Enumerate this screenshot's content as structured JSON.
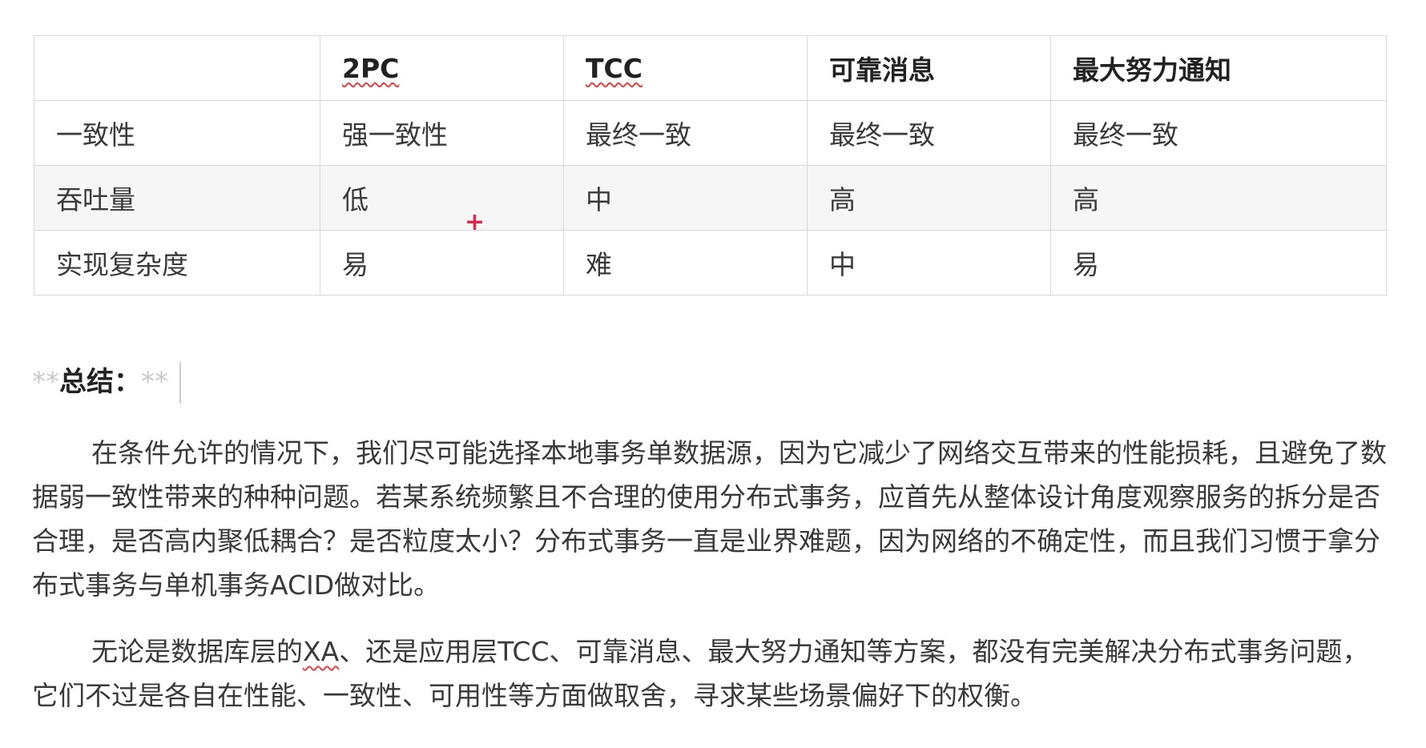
{
  "table": {
    "headers": [
      "",
      "2PC",
      "TCC",
      "可靠消息",
      "最大努力通知"
    ],
    "rows": [
      [
        "一致性",
        "强一致性",
        "最终一致",
        "最终一致",
        "最终一致"
      ],
      [
        "吞吐量",
        "低",
        "中",
        "高",
        "高"
      ],
      [
        "实现复杂度",
        "易",
        "难",
        "中",
        "易"
      ]
    ]
  },
  "marker": {
    "symbol": "+"
  },
  "summary": {
    "md_open": "**",
    "title": "总结：",
    "md_close": "**",
    "paragraph_1": "在条件允许的情况下，我们尽可能选择本地事务单数据源，因为它减少了网络交互带来的性能损耗，且避免了数据弱一致性带来的种种问题。若某系统频繁且不合理的使用分布式事务，应首先从整体设计角度观察服务的拆分是否合理，是否高内聚低耦合？是否粒度太小？分布式事务一直是业界难题，因为网络的不确定性，而且我们习惯于拿分布式事务与单机事务ACID做对比。",
    "paragraph_2_prefix": "无论是数据库层的",
    "paragraph_2_xa": "XA",
    "paragraph_2_rest": "、还是应用层TCC、可靠消息、最大努力通知等方案，都没有完美解决分布式事务问题，它们不过是各自在性能、一致性、可用性等方面做取舍，寻求某些场景偏好下的权衡。"
  },
  "colors": {
    "border": "#d9d9d9",
    "alt_row": "#f6f6f6",
    "spellcheck": "#e0433f",
    "marker": "#e0284c"
  }
}
